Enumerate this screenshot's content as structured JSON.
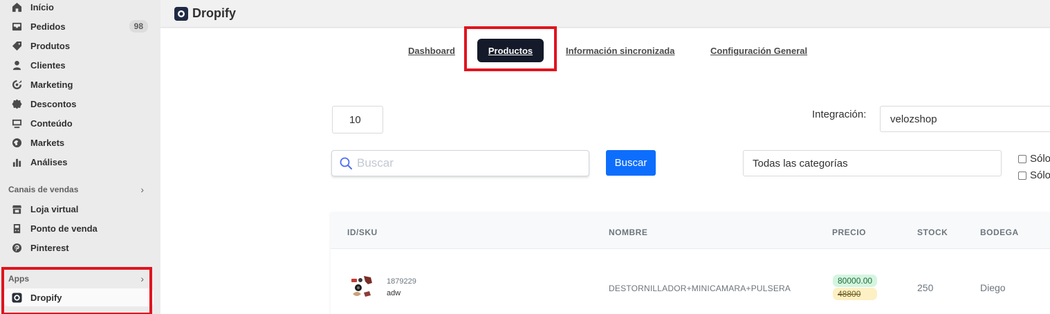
{
  "sidebar": {
    "items": [
      {
        "label": "Início",
        "icon": "home-icon"
      },
      {
        "label": "Pedidos",
        "icon": "inbox-icon",
        "badge": "98"
      },
      {
        "label": "Produtos",
        "icon": "tag-icon"
      },
      {
        "label": "Clientes",
        "icon": "person-icon"
      },
      {
        "label": "Marketing",
        "icon": "target-icon"
      },
      {
        "label": "Descontos",
        "icon": "discount-icon"
      },
      {
        "label": "Conteúdo",
        "icon": "content-icon"
      },
      {
        "label": "Markets",
        "icon": "globe-icon"
      },
      {
        "label": "Análises",
        "icon": "bar-chart-icon"
      }
    ],
    "sales_channels": {
      "heading": "Canais de vendas",
      "items": [
        {
          "label": "Loja virtual",
          "icon": "store-icon"
        },
        {
          "label": "Ponto de venda",
          "icon": "pos-icon"
        },
        {
          "label": "Pinterest",
          "icon": "pinterest-icon"
        }
      ]
    },
    "apps": {
      "heading": "Apps",
      "items": [
        {
          "label": "Dropify",
          "icon": "dropify-icon"
        }
      ]
    }
  },
  "header": {
    "title": "Dropify"
  },
  "tabs": [
    {
      "label": "Dashboard"
    },
    {
      "label": "Productos",
      "active": true
    },
    {
      "label": "Información sincronizada"
    },
    {
      "label": "Configuración General"
    }
  ],
  "filters": {
    "per_page": "10",
    "integration_label": "Integración:",
    "integration_value": "velozshop",
    "search_placeholder": "Buscar",
    "search_button": "Buscar",
    "category_value": "Todas las categorías",
    "checkbox_1": "Sólo",
    "checkbox_2": "Sólo"
  },
  "table": {
    "headers": [
      "ID/SKU",
      "NOMBRE",
      "PRECIO",
      "STOCK",
      "BODEGA"
    ],
    "rows": [
      {
        "sku": "1879229",
        "sku_name": "adw",
        "name": "DESTORNILLADOR+MINICAMARA+PULSERA",
        "price": "80000.00",
        "old_price": "48800",
        "stock": "250",
        "bodega": "Diego"
      }
    ]
  },
  "colors": {
    "highlight_box": "#e0141e",
    "active_tab": "#141a29",
    "primary_button": "#0d6efd",
    "price_badge": "#d4f5df",
    "old_price_badge": "#fdf0c4"
  }
}
